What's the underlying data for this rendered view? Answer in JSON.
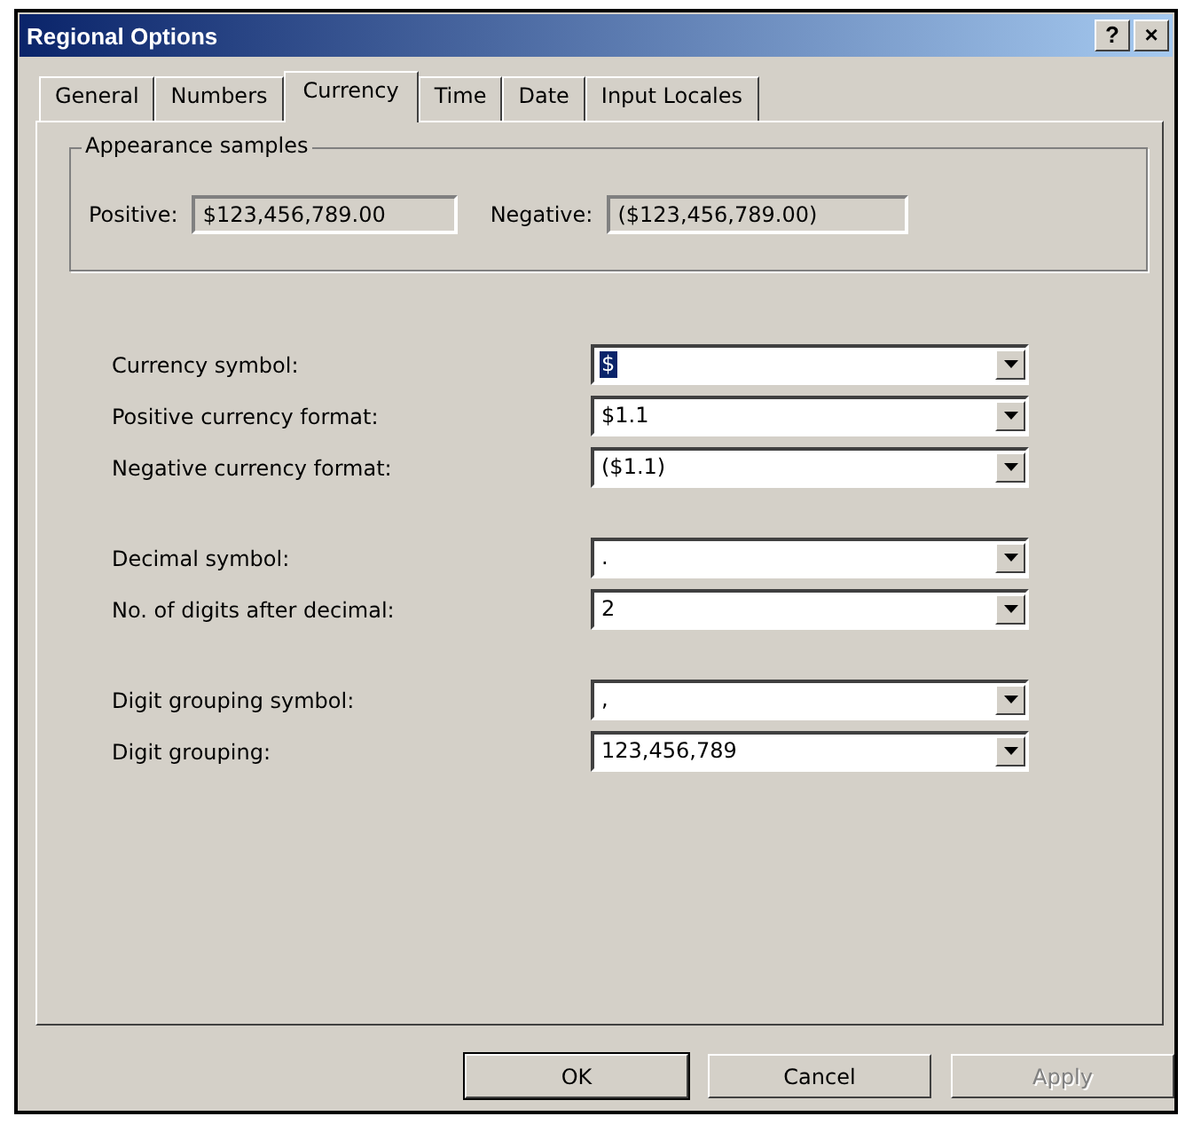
{
  "window": {
    "title": "Regional Options",
    "title_buttons": [
      "?",
      "×"
    ]
  },
  "tabs": [
    {
      "label": "General",
      "selected": false
    },
    {
      "label": "Numbers",
      "selected": false
    },
    {
      "label": "Currency",
      "selected": true
    },
    {
      "label": "Time",
      "selected": false
    },
    {
      "label": "Date",
      "selected": false
    },
    {
      "label": "Input Locales",
      "selected": false
    }
  ],
  "samples": {
    "title": "Appearance samples",
    "items": [
      {
        "label": "Positive:",
        "value": "$123,456,789.00"
      },
      {
        "label": "Negative:",
        "value": "($123,456,789.00)"
      }
    ]
  },
  "groups": [
    {
      "rows": [
        {
          "label": "Currency symbol:",
          "value": "$",
          "highlighted": true
        },
        {
          "label": "Positive currency format:",
          "value": "$1.1",
          "highlighted": false
        },
        {
          "label": "Negative currency format:",
          "value": "($1.1)",
          "highlighted": false
        }
      ]
    },
    {
      "rows": [
        {
          "label": "Decimal symbol:",
          "value": ".",
          "highlighted": false
        },
        {
          "label": "No. of digits after decimal:",
          "value": "2",
          "highlighted": false
        }
      ]
    },
    {
      "rows": [
        {
          "label": "Digit grouping symbol:",
          "value": ",",
          "highlighted": false
        },
        {
          "label": "Digit grouping:",
          "value": "123,456,789",
          "highlighted": false
        }
      ]
    }
  ],
  "buttons": [
    {
      "label": "OK",
      "default": true,
      "disabled": false
    },
    {
      "label": "Cancel",
      "default": false,
      "disabled": false
    },
    {
      "label": "Apply",
      "default": false,
      "disabled": true
    }
  ]
}
